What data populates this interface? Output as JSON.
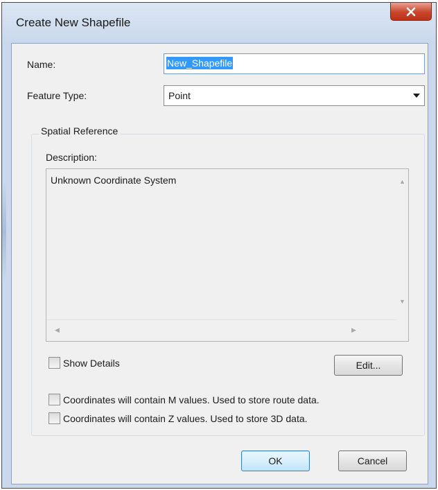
{
  "window": {
    "title": "Create New Shapefile",
    "close_icon": "close-icon"
  },
  "form": {
    "name_label": "Name:",
    "name_value": "New_Shapefile",
    "feature_type_label": "Feature Type:",
    "feature_type_value": "Point"
  },
  "spatial_reference": {
    "group_title": "Spatial Reference",
    "description_label": "Description:",
    "description_text": "Unknown Coordinate System",
    "show_details_label": "Show Details",
    "edit_button_label": "Edit...",
    "m_values_label": "Coordinates will contain M values. Used to store route data.",
    "z_values_label": "Coordinates will contain Z values. Used to store 3D data."
  },
  "buttons": {
    "ok_label": "OK",
    "cancel_label": "Cancel"
  },
  "colors": {
    "title_bar": "#c9d8ec",
    "close_button": "#c9442a",
    "selection": "#3399ff",
    "client_bg": "#f0f0f0"
  }
}
